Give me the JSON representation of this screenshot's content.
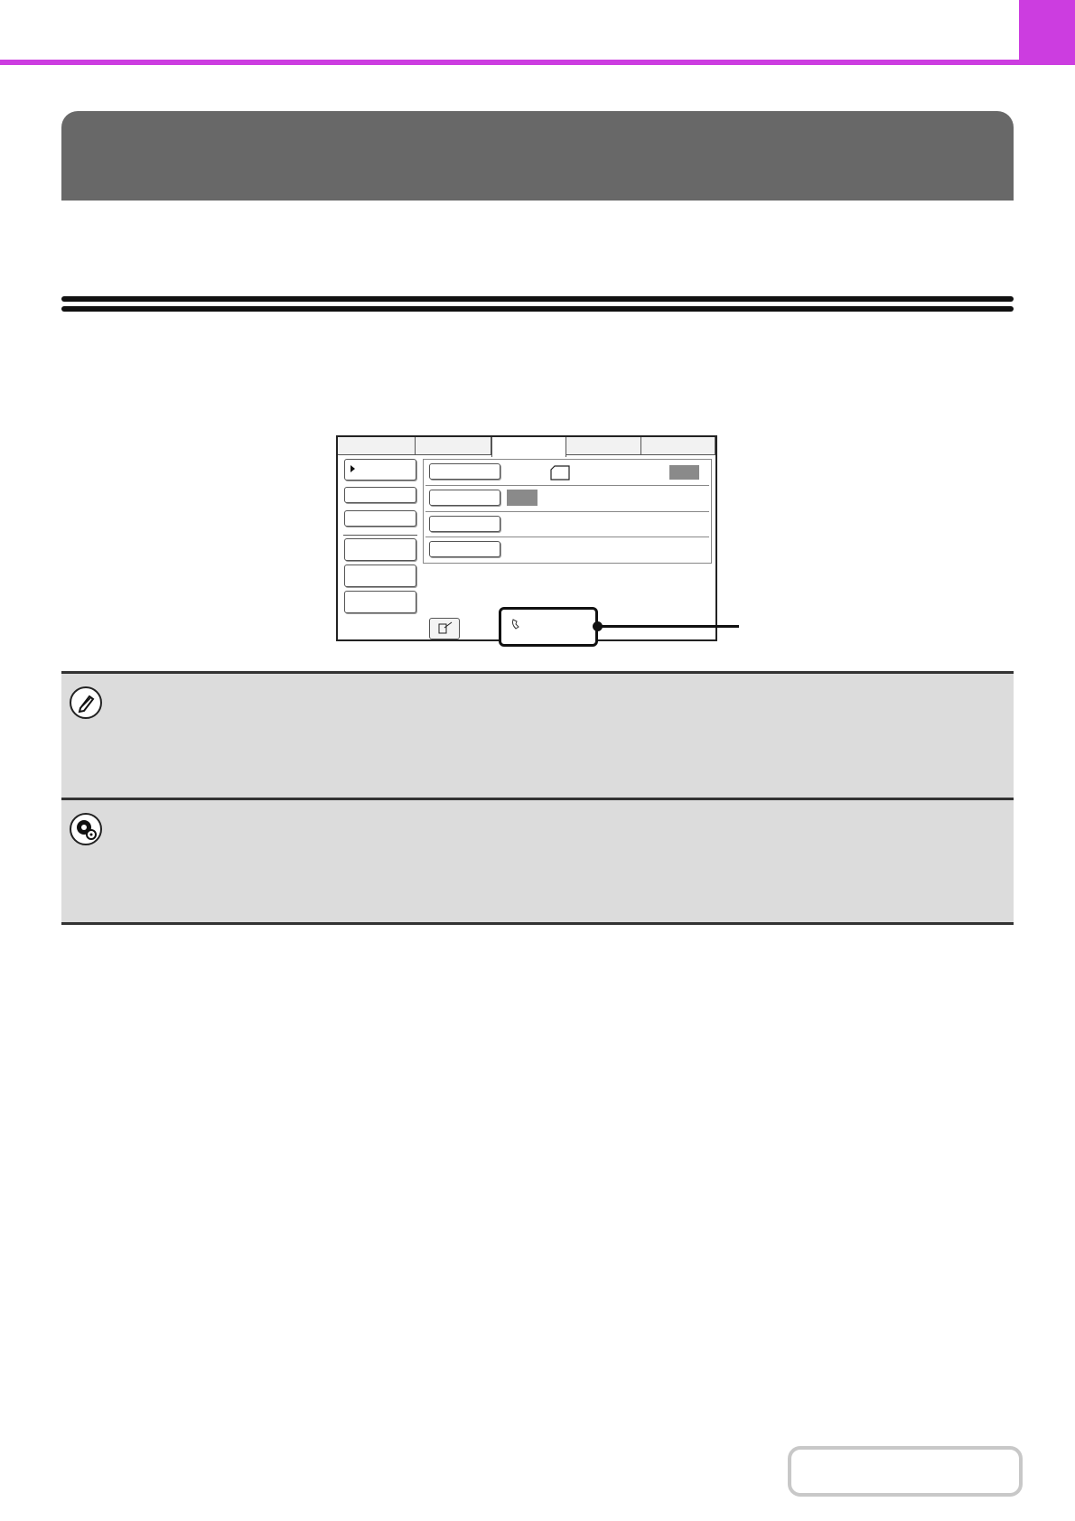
{
  "colors": {
    "accent": "#cc3de0",
    "title_band": "#686868",
    "note_bg": "#dcdcdc"
  },
  "header": {
    "title": ""
  },
  "section": {
    "heading": ""
  },
  "screen": {
    "tabs": [
      "",
      "",
      "",
      "",
      ""
    ],
    "side_buttons": [
      "",
      "",
      "",
      "",
      "",
      ""
    ],
    "rows": [
      "",
      "",
      "",
      ""
    ]
  },
  "notes": [
    {
      "icon": "pencil-icon",
      "text": ""
    },
    {
      "icon": "gear-icon",
      "text": ""
    }
  ],
  "footer": {
    "contents_label": ""
  }
}
